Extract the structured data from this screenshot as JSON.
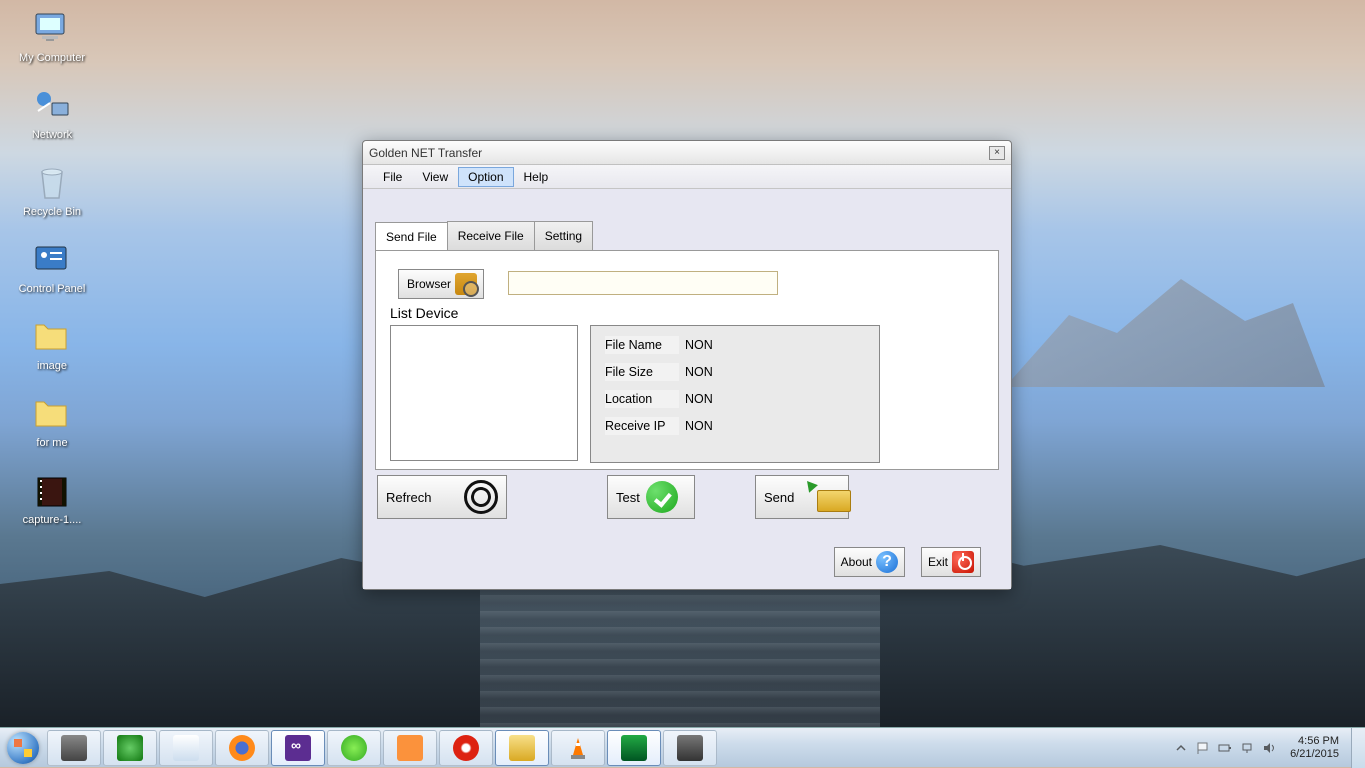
{
  "desktop": {
    "icons": [
      {
        "label": "My Computer"
      },
      {
        "label": "Network"
      },
      {
        "label": "Recycle Bin"
      },
      {
        "label": "Control Panel"
      },
      {
        "label": "image"
      },
      {
        "label": "for me"
      },
      {
        "label": "capture-1...."
      }
    ]
  },
  "window": {
    "title": "Golden NET Transfer",
    "menu": {
      "file": "File",
      "view": "View",
      "option": "Option",
      "help": "Help"
    },
    "tabs": {
      "send": "Send File",
      "receive": "Receive File",
      "setting": "Setting"
    },
    "browser_label": "Browser",
    "list_label": "List Device",
    "path_value": "",
    "info": {
      "filename_k": "File Name",
      "filename_v": "NON",
      "filesize_k": "File Size",
      "filesize_v": "NON",
      "location_k": "Location",
      "location_v": "NON",
      "receiveip_k": "Receive IP",
      "receiveip_v": "NON"
    },
    "buttons": {
      "refresh": "Refrech",
      "test": "Test",
      "send": "Send",
      "about": "About",
      "exit": "Exit"
    }
  },
  "taskbar": {
    "time": "4:56 PM",
    "date": "6/21/2015"
  }
}
